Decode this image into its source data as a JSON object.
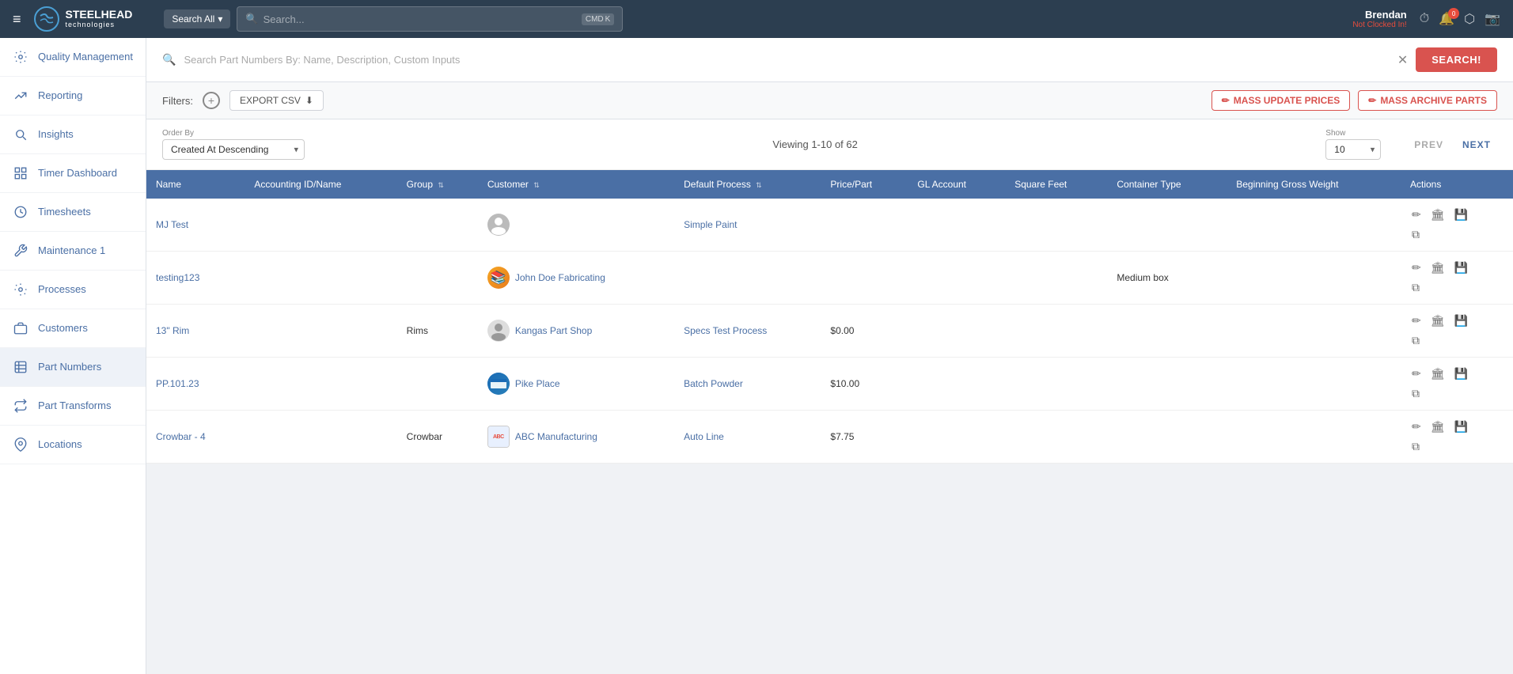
{
  "topnav": {
    "menu_icon": "≡",
    "logo_text": "STEELHEAD",
    "logo_sub": "technologies",
    "search_scope": "Search All",
    "search_placeholder": "Search...",
    "kbd_cmd": "CMD",
    "kbd_key": "K",
    "user_name": "Brendan",
    "user_status": "Not Clocked In!"
  },
  "sidebar": {
    "items": [
      {
        "id": "quality-management",
        "label": "Quality Management",
        "icon": "gear"
      },
      {
        "id": "reporting",
        "label": "Reporting",
        "icon": "chart-line"
      },
      {
        "id": "insights",
        "label": "Insights",
        "icon": "search-circle"
      },
      {
        "id": "timer-dashboard",
        "label": "Timer Dashboard",
        "icon": "grid"
      },
      {
        "id": "timesheets",
        "label": "Timesheets",
        "icon": "clock"
      },
      {
        "id": "maintenance",
        "label": "Maintenance 1",
        "icon": "wrench"
      },
      {
        "id": "processes",
        "label": "Processes",
        "icon": "gear-small"
      },
      {
        "id": "customers",
        "label": "Customers",
        "icon": "briefcase"
      },
      {
        "id": "part-numbers",
        "label": "Part Numbers",
        "icon": "table"
      },
      {
        "id": "part-transforms",
        "label": "Part Transforms",
        "icon": "arrows"
      },
      {
        "id": "locations",
        "label": "Locations",
        "icon": "pin"
      }
    ]
  },
  "search_bar": {
    "placeholder": "Search Part Numbers By: Name, Description, Custom Inputs",
    "button_label": "SEARCH!"
  },
  "toolbar": {
    "filters_label": "Filters:",
    "export_label": "EXPORT CSV",
    "mass_update_label": "MASS UPDATE PRICES",
    "mass_archive_label": "MASS ARCHIVE PARTS"
  },
  "table_controls": {
    "order_by_label": "Order By",
    "order_by_value": "Created At Descending",
    "viewing_text": "Viewing 1-10 of 62",
    "show_label": "Show",
    "show_value": "10",
    "prev_label": "PREV",
    "next_label": "NEXT"
  },
  "table": {
    "columns": [
      {
        "id": "name",
        "label": "Name"
      },
      {
        "id": "accounting-id",
        "label": "Accounting ID/Name"
      },
      {
        "id": "group",
        "label": "Group",
        "sortable": true
      },
      {
        "id": "customer",
        "label": "Customer",
        "sortable": true
      },
      {
        "id": "default-process",
        "label": "Default Process",
        "sortable": true
      },
      {
        "id": "price-part",
        "label": "Price/Part"
      },
      {
        "id": "gl-account",
        "label": "GL Account"
      },
      {
        "id": "square-feet",
        "label": "Square Feet"
      },
      {
        "id": "container-type",
        "label": "Container Type"
      },
      {
        "id": "beginning-gross-weight",
        "label": "Beginning Gross Weight"
      },
      {
        "id": "actions",
        "label": "Actions"
      }
    ],
    "rows": [
      {
        "id": "mj-test",
        "name": "MJ Test",
        "accounting_id": "",
        "group": "",
        "customer_avatar_type": "placeholder",
        "customer_name": "",
        "customer_link": false,
        "default_process": "Simple Paint",
        "price_part": "",
        "gl_account": "",
        "square_feet": "",
        "container_type": "",
        "beginning_gross_weight": ""
      },
      {
        "id": "testing123",
        "name": "testing123",
        "accounting_id": "",
        "group": "",
        "customer_avatar_type": "jdf",
        "customer_name": "John Doe Fabricating",
        "customer_link": true,
        "default_process": "",
        "price_part": "",
        "gl_account": "",
        "square_feet": "",
        "container_type": "Medium box",
        "beginning_gross_weight": ""
      },
      {
        "id": "13-rim",
        "name": "13\" Rim",
        "accounting_id": "",
        "group": "Rims",
        "customer_avatar_type": "placeholder",
        "customer_name": "Kangas Part Shop",
        "customer_link": true,
        "default_process": "Specs Test Process",
        "price_part": "$0.00",
        "gl_account": "",
        "square_feet": "",
        "container_type": "",
        "beginning_gross_weight": ""
      },
      {
        "id": "pp-101-23",
        "name": "PP.101.23",
        "accounting_id": "",
        "group": "",
        "customer_avatar_type": "pp",
        "customer_name": "Pike Place",
        "customer_link": true,
        "default_process": "Batch Powder",
        "price_part": "$10.00",
        "gl_account": "",
        "square_feet": "",
        "container_type": "",
        "beginning_gross_weight": ""
      },
      {
        "id": "crowbar-4",
        "name": "Crowbar - 4",
        "accounting_id": "",
        "group": "Crowbar",
        "customer_avatar_type": "abc",
        "customer_name": "ABC Manufacturing",
        "customer_link": true,
        "default_process": "Auto Line",
        "price_part": "$7.75",
        "gl_account": "",
        "square_feet": "",
        "container_type": "",
        "beginning_gross_weight": ""
      }
    ]
  }
}
